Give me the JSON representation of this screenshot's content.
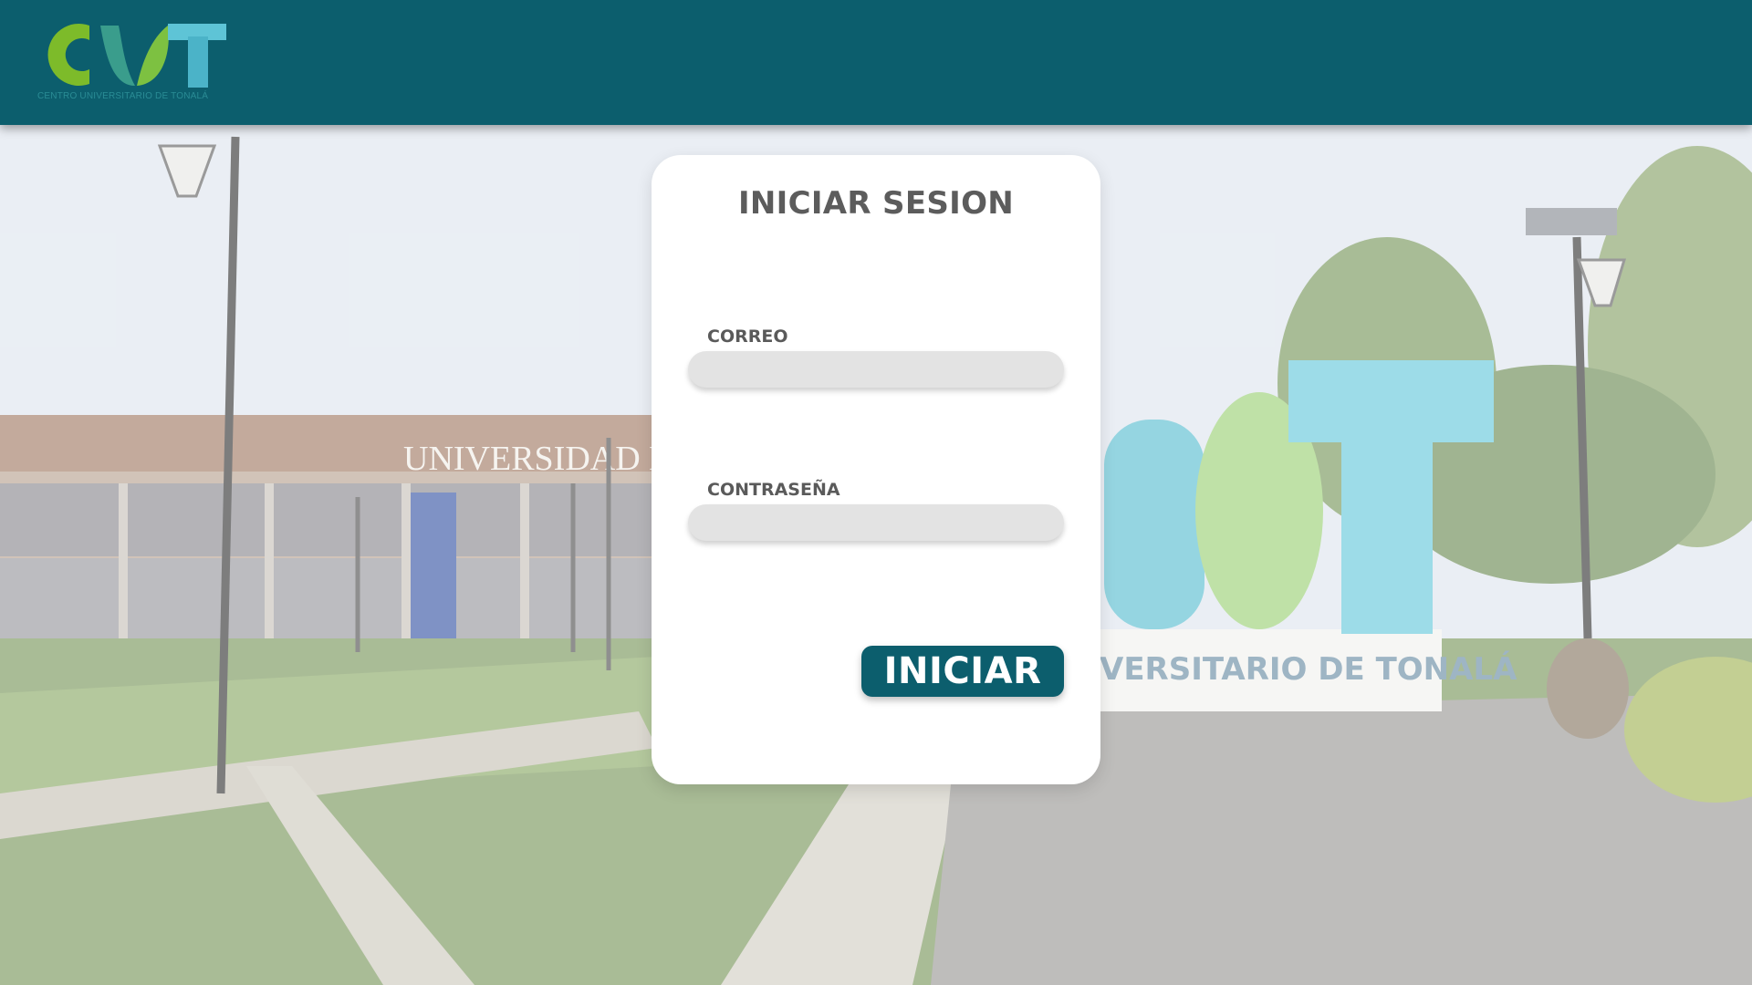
{
  "header": {
    "logo": {
      "wordmark": "CUT",
      "caption": "CENTRO UNIVERSITARIO DE TONALÁ",
      "colors": {
        "c": "#7dbb2a",
        "u": "#4a9d6c",
        "t": "#5ec4d6"
      }
    },
    "background_color": "#0c5e6d"
  },
  "background": {
    "building_sign": "UNIVERSIDAD D",
    "monument_sign": "VERSITARIO DE TONALÁ",
    "monument_letters": "CUT"
  },
  "login": {
    "title": "INICIAR SESION",
    "email_label": "CORREO",
    "email_value": "",
    "password_label": "CONTRASEÑA",
    "password_value": "",
    "submit_label": "INICIAR"
  },
  "colors": {
    "primary": "#0c5e6d",
    "card": "#ffffff",
    "input_bg": "#e3e3e3",
    "label_text": "#5a5a5a"
  }
}
